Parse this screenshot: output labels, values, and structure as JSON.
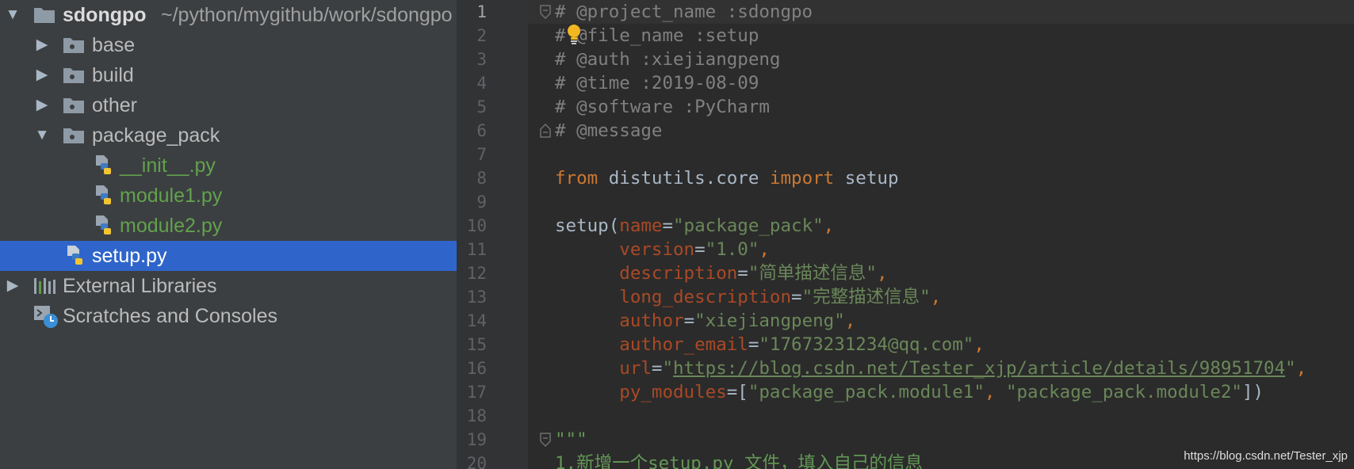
{
  "project_tree": {
    "root": {
      "name": "sdongpo",
      "path": "~/python/mygithub/work/sdongpo"
    },
    "folders": [
      "base",
      "build",
      "other",
      "package_pack"
    ],
    "package_files": [
      "__init__.py",
      "module1.py",
      "module2.py"
    ],
    "selected_file": "setup.py",
    "external_libraries": "External Libraries",
    "scratches": "Scratches and Consoles"
  },
  "editor": {
    "current_line": 1,
    "line_numbers": [
      "1",
      "2",
      "3",
      "4",
      "5",
      "6",
      "7",
      "8",
      "9",
      "10",
      "11",
      "12",
      "13",
      "14",
      "15",
      "16",
      "17",
      "18",
      "19",
      "20"
    ],
    "code": {
      "l1": "# @project_name :sdongpo",
      "l2": "# @file_name :setup",
      "l3": "# @auth :xiejiangpeng",
      "l4": "# @time :2019-08-09",
      "l5": "# @software :PyCharm",
      "l6": "# @message",
      "l8_from": "from",
      "l8_module": "distutils.core",
      "l8_import": "import",
      "l8_name": "setup",
      "l10_func": "setup(",
      "l10_arg": "name",
      "l10_val": "\"package_pack\"",
      "l11_arg": "version",
      "l11_val": "\"1.0\"",
      "l12_arg": "description",
      "l12_val": "\"简单描述信息\"",
      "l13_arg": "long_description",
      "l13_val": "\"完整描述信息\"",
      "l14_arg": "author",
      "l14_val": "\"xiejiangpeng\"",
      "l15_arg": "author_email",
      "l15_val": "\"17673231234@qq.com\"",
      "l16_arg": "url",
      "l16_q": "\"",
      "l16_link": "https://blog.csdn.net/Tester_xjp/article/details/98951704",
      "l17_arg": "py_modules",
      "l17_v1": "\"package_pack.module1\"",
      "l17_v2": "\"package_pack.module2\"",
      "l19": "\"\"\"",
      "l20": "1.新增一个setup.py 文件，填入自己的信息"
    }
  },
  "watermark": "https://blog.csdn.net/Tester_xjp",
  "colors": {
    "tree_bg": "#3c3f41",
    "selection": "#2f65ca",
    "editor_bg": "#2b2b2b",
    "keyword": "#cc7832",
    "string": "#6a8759",
    "comment": "#808080",
    "param": "#aa4926"
  },
  "icons": [
    "expand-arrow-icon",
    "collapse-arrow-icon",
    "folder-icon",
    "python-file-icon",
    "library-icon",
    "scratches-icon",
    "lightbulb-icon",
    "fold-icon"
  ]
}
